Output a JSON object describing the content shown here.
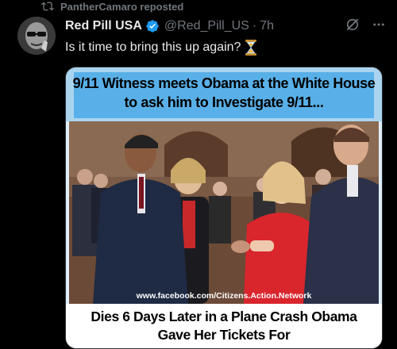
{
  "repost": {
    "label": "PantherCamaro reposted"
  },
  "tweet": {
    "author_name": "Red Pill USA",
    "handle": "@Red_Pill_US",
    "separator": "·",
    "time": "7h",
    "text": "Is it time to bring this up again?"
  },
  "image": {
    "top_line_1": "9/11 Witness meets Obama at the White House",
    "top_line_2": "to ask him to Investigate 9/11...",
    "watermark": "www.facebook.com/Citizens.Action.Network",
    "bottom_line_1": "Dies 6 Days Later in a Plane Crash Obama",
    "bottom_line_2": "Gave Her Tickets For"
  },
  "icons": [
    "repost-icon",
    "verified-badge-icon",
    "grok-icon",
    "more-options-icon",
    "hourglass-emoji-icon"
  ],
  "colors": {
    "background": "#000000",
    "text": "#e7e9ea",
    "muted": "#71767b",
    "verified": "#1d9bf0",
    "banner": "#59b0e8"
  }
}
